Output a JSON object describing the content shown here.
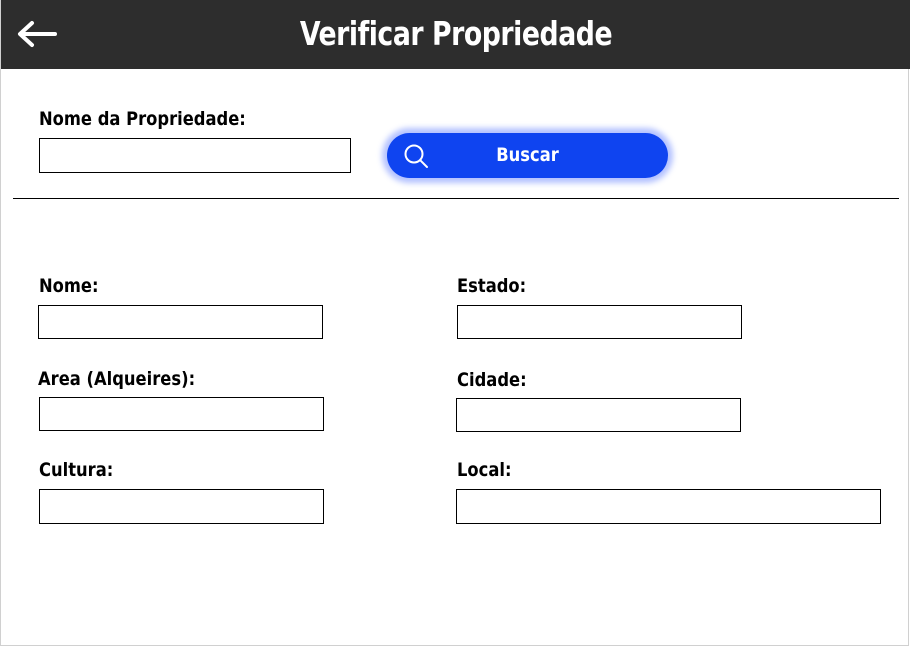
{
  "header": {
    "title": "Verificar Propriedade",
    "back_icon": "arrow-left-icon",
    "background": "#2d2d2d"
  },
  "search": {
    "label": "Nome da Propriedade:",
    "value": "",
    "button_label": "Buscar",
    "button_icon": "search-icon",
    "button_color": "#0f44f0"
  },
  "details": {
    "nome_label": "Nome:",
    "nome_value": "",
    "estado_label": "Estado:",
    "estado_value": "",
    "area_label": "Area (Alqueires):",
    "area_value": "",
    "cidade_label": "Cidade:",
    "cidade_value": "",
    "cultura_label": "Cultura:",
    "cultura_value": "",
    "local_label": "Local:",
    "local_value": ""
  }
}
